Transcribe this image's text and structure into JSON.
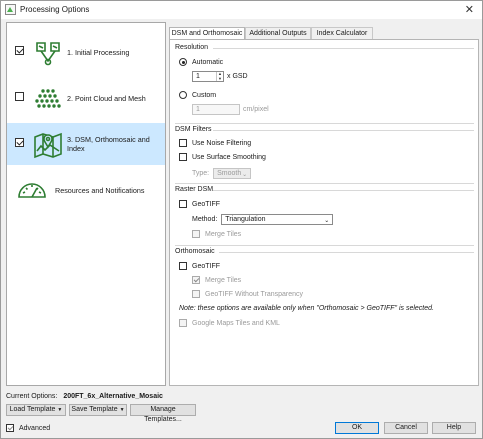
{
  "window": {
    "title": "Processing Options",
    "close_glyph": "✕"
  },
  "steps": [
    {
      "label": "1. Initial Processing",
      "checked": true,
      "icon": "initial-processing-icon"
    },
    {
      "label": "2. Point Cloud and Mesh",
      "checked": false,
      "icon": "point-cloud-icon"
    },
    {
      "label": "3. DSM, Orthomosaic and Index",
      "checked": true,
      "icon": "dsm-map-icon"
    },
    {
      "label": "Resources and Notifications",
      "icon": "gauge-icon"
    }
  ],
  "tabs": [
    "DSM and Orthomosaic",
    "Additional Outputs",
    "Index Calculator"
  ],
  "resolution": {
    "title": "Resolution",
    "automatic_label": "Automatic",
    "gsd_value": "1",
    "gsd_unit": "x GSD",
    "custom_label": "Custom",
    "custom_value": "1",
    "custom_unit": "cm/pixel"
  },
  "dsm_filters": {
    "title": "DSM Filters",
    "noise_label": "Use Noise Filtering",
    "smoothing_label": "Use Surface Smoothing",
    "type_label": "Type:",
    "type_value": "Smooth"
  },
  "raster_dsm": {
    "title": "Raster DSM",
    "geotiff_label": "GeoTIFF",
    "method_label": "Method:",
    "method_value": "Triangulation",
    "merge_label": "Merge Tiles"
  },
  "orthomosaic": {
    "title": "Orthomosaic",
    "geotiff_label": "GeoTIFF",
    "merge_label": "Merge Tiles",
    "no_transparency_label": "GeoTIFF Without Transparency",
    "note": "Note: these options are available only when \"Orthomosaic > GeoTIFF\" is selected.",
    "google_label": "Google Maps Tiles and KML"
  },
  "footer": {
    "current_label": "Current Options:",
    "current_value": "200FT_6x_Alternative_Mosaic",
    "load_label": "Load Template",
    "save_label": "Save Template",
    "manage_label": "Manage Templates...",
    "advanced_label": "Advanced",
    "ok_label": "OK",
    "cancel_label": "Cancel",
    "help_label": "Help"
  },
  "colors": {
    "accent": "#2e7d32",
    "selection": "#cce8ff",
    "primary_border": "#0078d7"
  }
}
